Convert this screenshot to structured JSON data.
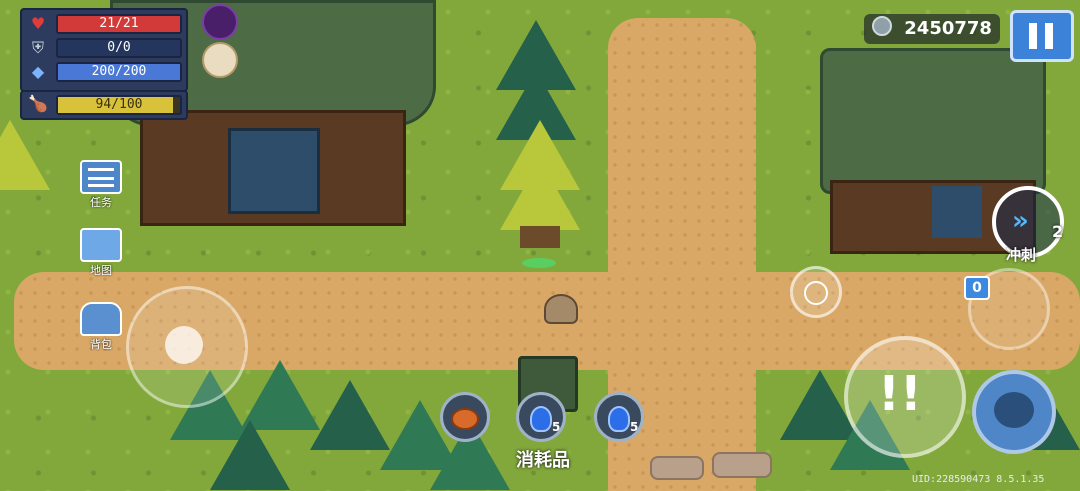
{
  "hud": {
    "hp": "21/21",
    "hp_fill": 1.0,
    "armor": "0/0",
    "armor_fill": 0.0,
    "mana": "200/200",
    "mana_fill": 1.0,
    "energy": "94/100",
    "energy_fill": 0.94
  },
  "side_buttons": [
    {
      "label": "任务",
      "icon": "task-list-icon"
    },
    {
      "label": "地图",
      "icon": "map-icon"
    },
    {
      "label": "背包",
      "icon": "backpack-icon"
    }
  ],
  "consumables": {
    "label": "消耗品",
    "slots": [
      {
        "icon": "roast-meat-icon",
        "count": ""
      },
      {
        "icon": "blue-potion-icon",
        "count": "5"
      },
      {
        "icon": "blue-potion-icon",
        "count": "5"
      }
    ]
  },
  "coins": "2450778",
  "skill": {
    "label": "冲刺",
    "count": "2"
  },
  "weapon_swap_count": "0",
  "uid_version": "UID:228590473 8.5.1.35",
  "colors": {
    "hp_bar": "#d23a3a",
    "armor_bar": "#3d6fc2",
    "mana_bar": "#4a78d6",
    "energy_bar": "#d8c23a",
    "panel": "#2d3b5e",
    "pause_button": "#3c82d8"
  }
}
